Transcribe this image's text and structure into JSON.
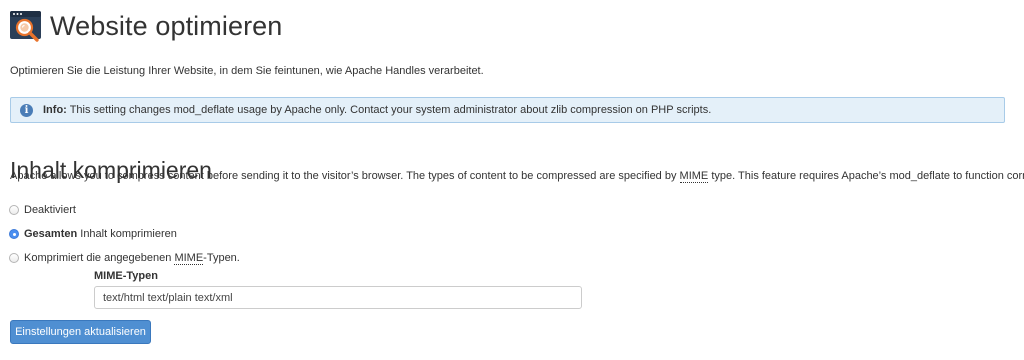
{
  "header": {
    "icon": "website-optimize-magnifier-icon",
    "title": "Website optimieren",
    "description": "Optimieren Sie die Leistung Ihrer Website, in dem Sie feintunen, wie Apache Handles verarbeitet."
  },
  "info": {
    "icon": "info-circle-icon",
    "label": "Info:",
    "text": "This setting changes mod_deflate usage by Apache only. Contact your system administrator about zlib compression on PHP scripts."
  },
  "section": {
    "title": "Inhalt komprimieren",
    "desc_before": "Apache allows you to compress content before sending it to the visitor’s browser. The types of content to be compressed are specified by ",
    "desc_abbr": "MIME",
    "desc_after": " type. This feature requires Apache’s mod_deflate to function correctly."
  },
  "options": {
    "disabled_label": "Deaktiviert",
    "all_strong": "Gesamten",
    "all_rest": " Inhalt komprimieren",
    "mime_before": "Komprimiert die angegebenen ",
    "mime_abbr": "MIME",
    "mime_after": "-Typen.",
    "selected": "Gesamten Inhalt komprimieren"
  },
  "mime_field": {
    "label": "MIME-Typen",
    "value": "text/html text/plain text/xml"
  },
  "submit": {
    "label": "Einstellungen aktualisieren"
  },
  "colors": {
    "info_background": "#e4f0f9",
    "info_border": "#a8cbe8",
    "button_primary": "#4f8fd2",
    "radio_checked": "#4a8ef0"
  }
}
